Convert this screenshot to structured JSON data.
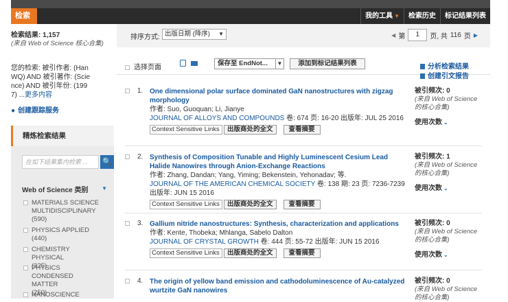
{
  "header": {
    "search_tab": "检索",
    "tools": [
      "我的工具",
      "检索历史",
      "标记结果列表"
    ]
  },
  "left": {
    "results_label": "检索结果: 1,157",
    "results_source": "(来自 Web of Science 核心合集)",
    "query_lines": [
      "您的检索: 被引作者: (Han",
      "WQ) AND 被引著作: (Scie",
      "nce) AND 被引年份: (199",
      "7) ..."
    ],
    "more": "更多内容",
    "alert": "创建跟踪服务",
    "refine": "精炼检索结果",
    "search_placeholder": "在如下结果集内检索 ...",
    "category_head": "Web of Science 类别",
    "categories": [
      {
        "name": "MATERIALS SCIENCE MULTIDISCIPLINARY",
        "count": "(590)"
      },
      {
        "name": "PHYSICS APPLIED",
        "count": "(440)"
      },
      {
        "name": "CHEMISTRY PHYSICAL",
        "count": "(325)"
      },
      {
        "name": "PHYSICS CONDENSED MATTER",
        "count": "(250)"
      },
      {
        "name": "NANOSCIENCE",
        "count": ""
      }
    ]
  },
  "sortbar": {
    "label": "排序方式:",
    "value": "出版日期 (降序)",
    "page_label": "第",
    "page": "1",
    "page_of": "页, 共",
    "total": "116",
    "page_suffix": "页"
  },
  "toolbar": {
    "select_page": "选择页面",
    "save": "保存至 EndNot...",
    "add": "添加到标记结果列表",
    "analyze": "分析检索结果",
    "citation": "创建引文报告"
  },
  "records": [
    {
      "num": "1.",
      "title": "One dimensional polar surface dominated GaN nanostructures with zigzag morphology",
      "authors": "作者: Suo, Guoquan; Li, Jianye",
      "journal": "JOURNAL OF ALLOYS AND COMPOUNDS",
      "details": "卷: 674  页: 16-20  出版年: JUL 25 2016",
      "context": "Context Sensitive Links",
      "fulltext": "出版商处的全文",
      "abstract": "查看摘要",
      "cited": "被引频次: 0",
      "cited_src": "(来自 Web of Science 的核心合集)",
      "usage": "使用次数"
    },
    {
      "num": "2.",
      "title": "Synthesis of Composition Tunable and Highly Luminescent Cesium Lead Halide Nanowires through Anion-Exchange Reactions",
      "authors": "作者: Zhang, Dandan; Yang, Yiming; Bekenstein, Yehonadav; 等.",
      "journal": "JOURNAL OF THE AMERICAN CHEMICAL SOCIETY",
      "details": "卷: 138  期: 23  页: 7236-7239  出版年: JUN 15 2016",
      "context": "Context Sensitive Links",
      "fulltext": "出版商处的全文",
      "abstract": "查看摘要",
      "cited": "被引频次: 1",
      "cited_src": "(来自 Web of Science 的核心合集)",
      "usage": "使用次数"
    },
    {
      "num": "3.",
      "title": "Gallium nitride nanostructures: Synthesis, characterization and applications",
      "authors": "作者: Kente, Thobeka; Mhlanga, Sabelo Dalton",
      "journal": "JOURNAL OF CRYSTAL GROWTH",
      "details": "卷: 444  页: 55-72  出版年: JUN 15 2016",
      "context": "Context Sensitive Links",
      "fulltext": "出版商处的全文",
      "abstract": "查看摘要",
      "cited": "被引频次: 0",
      "cited_src": "(来自 Web of Science 的核心合集)",
      "usage": "使用次数"
    },
    {
      "num": "4.",
      "title": "The origin of yellow band emission and cathodoluminescence of Au-catalyzed wurtzite GaN nanowires",
      "authors": "",
      "journal": "",
      "details": "",
      "context": "",
      "fulltext": "",
      "abstract": "",
      "cited": "被引频次: 0",
      "cited_src": "(来自 Web of Science 的核心合集)",
      "usage": ""
    }
  ],
  "colors": {
    "accent": "#e87722",
    "link": "#1a5aa0",
    "dark_bar": "#2b2b2b"
  }
}
